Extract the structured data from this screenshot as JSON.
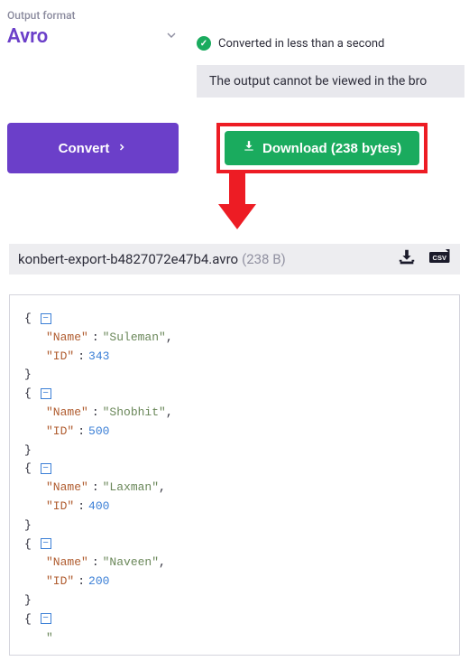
{
  "format": {
    "label": "Output format",
    "value": "Avro"
  },
  "status": {
    "text": "Converted in less than a second"
  },
  "output_notice": "The output cannot be viewed in the bro",
  "buttons": {
    "convert": "Convert",
    "download": "Download (238 bytes)"
  },
  "file": {
    "name": "konbert-export-b4827072e47b4.avro",
    "size": "(238 B)"
  },
  "records": [
    {
      "Name": "Suleman",
      "ID": 343
    },
    {
      "Name": "Shobhit",
      "ID": 500
    },
    {
      "Name": "Laxman",
      "ID": 400
    },
    {
      "Name": "Naveen",
      "ID": 200
    }
  ],
  "code_keys": {
    "name": "\"Name\"",
    "id": "\"ID\""
  }
}
